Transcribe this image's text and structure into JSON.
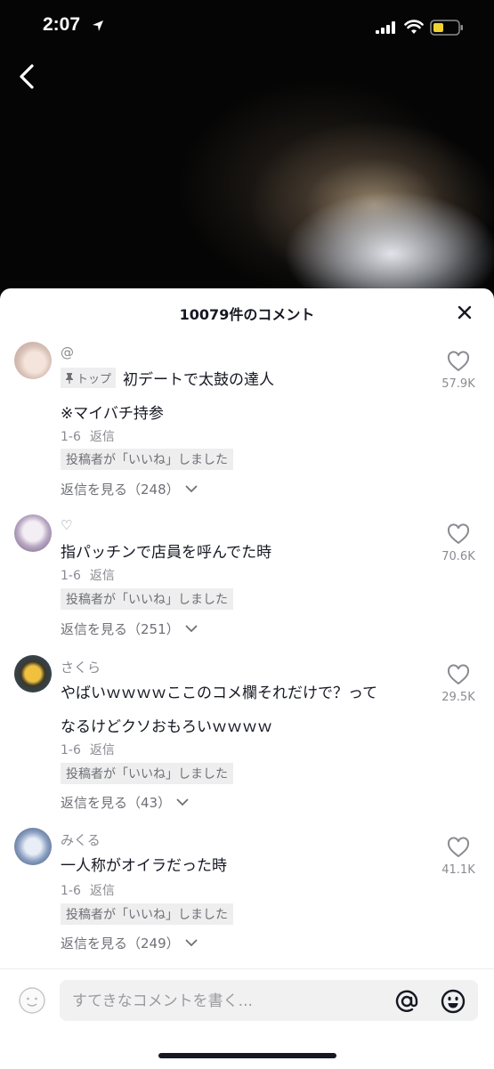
{
  "status_bar": {
    "time": "2:07"
  },
  "sheet": {
    "title": "10079件のコメント"
  },
  "comments": [
    {
      "username": "@",
      "tag": "トップ",
      "line1": "初デートで太鼓の達人",
      "line2": "※マイバチ持参",
      "date": "1-6",
      "reply": "返信",
      "liked_label": "投稿者が「いいね」しました",
      "view_replies": "返信を見る（248）",
      "likes": "57.9K"
    },
    {
      "username": "♡",
      "line1": "指パッチンで店員を呼んでた時",
      "date": "1-6",
      "reply": "返信",
      "liked_label": "投稿者が「いいね」しました",
      "view_replies": "返信を見る（251）",
      "likes": "70.6K"
    },
    {
      "username": "さくら",
      "line1": "やばいｗｗｗｗここのコメ欄それだけで？って",
      "line2": "なるけどクソおもろいｗｗｗｗ",
      "date": "1-6",
      "reply": "返信",
      "liked_label": "投稿者が「いいね」しました",
      "view_replies": "返信を見る（43）",
      "likes": "29.5K"
    },
    {
      "username": "みくる",
      "line1": "一人称がオイラだった時",
      "date": "1-6",
      "reply": "返信",
      "liked_label": "投稿者が「いいね」しました",
      "view_replies": "返信を見る（249）",
      "likes": "41.1K"
    }
  ],
  "input": {
    "placeholder": "すてきなコメントを書く..."
  },
  "icons": {
    "back": "chevron-left-icon",
    "close": "close-icon",
    "like": "heart-outline-icon",
    "pin": "pin-icon",
    "mention": "at-sign-icon",
    "emoji": "smiley-icon"
  },
  "colors": {
    "sheet_bg": "#ffffff",
    "text_primary": "#161823",
    "text_secondary": "#8a8b91",
    "tag_bg": "#eeeeef",
    "input_bg": "#f1f1f2",
    "battery_fill": "#f2d230"
  }
}
